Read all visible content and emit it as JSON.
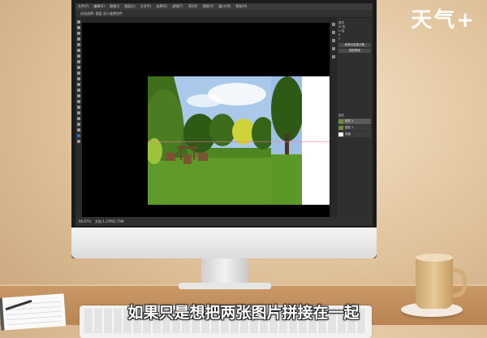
{
  "watermark": "天气+",
  "app": {
    "menu": [
      "文件(F)",
      "编辑(E)",
      "图像(I)",
      "图层(L)",
      "文字(Y)",
      "选择(S)",
      "滤镜(T)",
      "3D(D)",
      "视图(V)",
      "窗口(W)",
      "帮助(H)"
    ],
    "options_text": "自动选择: 图层 显示变换控件",
    "tab_title": "未标题-1 @ 66.7% (RGB/8#) ×",
    "status": {
      "zoom": "66.67%",
      "doc": "文档:1.37M/2.75M"
    },
    "panels": {
      "properties_title": "属性",
      "lines": [
        "W 宽",
        "H 高",
        "X",
        "Y"
      ],
      "button_1": "转换为智能对象",
      "button_2": "图层蒙版",
      "layers_title": "图层",
      "layers": [
        {
          "name": "图层 2",
          "thumb": "photo"
        },
        {
          "name": "图层 1",
          "thumb": "photo"
        },
        {
          "name": "背景",
          "thumb": "white"
        }
      ]
    }
  },
  "subtitle": "如果只是想把两张图片拼接在一起",
  "colors": {
    "sky": "#a9c8ea",
    "grass": "#5f9a2a",
    "tree": "#3f6e1d",
    "accent": "#1f6fd6"
  }
}
